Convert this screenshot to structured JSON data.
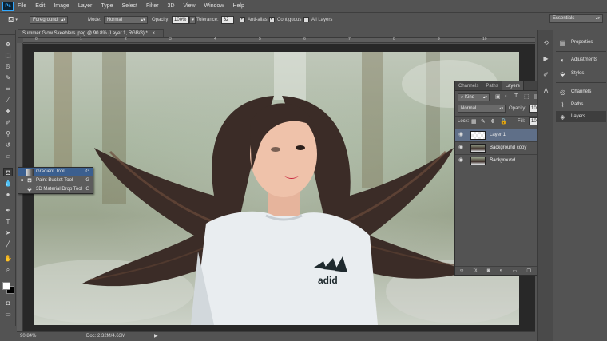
{
  "app": {
    "logo": "Ps"
  },
  "menu": [
    "File",
    "Edit",
    "Image",
    "Layer",
    "Type",
    "Select",
    "Filter",
    "3D",
    "View",
    "Window",
    "Help"
  ],
  "options": {
    "tool_icon": "paint-bucket-icon",
    "fill_source": "Foreground",
    "mode_label": "Mode:",
    "mode_value": "Normal",
    "opacity_label": "Opacity:",
    "opacity_value": "100%",
    "tolerance_label": "Tolerance:",
    "tolerance_value": "32",
    "antialias_label": "Anti-alias",
    "antialias_checked": true,
    "contiguous_label": "Contiguous",
    "contiguous_checked": true,
    "all_layers_label": "All Layers",
    "all_layers_checked": false,
    "workspace": "Essentials"
  },
  "document": {
    "tab_title": "Summer Glow Skeeblers.jpeg @ 90.8% (Layer 1, RGB/8) *",
    "close_glyph": "×"
  },
  "ruler_top_labels": [
    "0",
    "1",
    "2",
    "3",
    "4",
    "5",
    "6",
    "7",
    "8",
    "9",
    "10"
  ],
  "flyout": [
    {
      "label": "Gradient Tool",
      "key": "G",
      "icon": "gradient-icon",
      "selected": true,
      "bullet": ""
    },
    {
      "label": "Paint Bucket Tool",
      "key": "G",
      "icon": "paint-bucket-icon",
      "selected": false,
      "bullet": "■"
    },
    {
      "label": "3D Material Drop Tool",
      "key": "G",
      "icon": "3d-material-drop-icon",
      "selected": false,
      "bullet": ""
    }
  ],
  "layers_panel": {
    "tabs": [
      "Channels",
      "Paths",
      "Layers"
    ],
    "active_tab": "Layers",
    "kind_label": "Kind",
    "blend_mode": "Normal",
    "opacity_label": "Opacity:",
    "opacity_value": "100%",
    "lock_label": "Lock:",
    "fill_label": "Fill:",
    "fill_value": "100%",
    "layers": [
      {
        "name": "Layer 1",
        "selected": true,
        "italic": false,
        "locked": false
      },
      {
        "name": "Background copy",
        "selected": false,
        "italic": false,
        "locked": false
      },
      {
        "name": "Background",
        "selected": false,
        "italic": true,
        "locked": true
      }
    ],
    "bottom_icons": [
      "link-icon",
      "fx-icon",
      "mask-icon",
      "adjustment-icon",
      "group-icon",
      "new-layer-icon",
      "trash-icon"
    ],
    "fx_label": "fx"
  },
  "right_panel": [
    {
      "label": "Properties",
      "icon": "properties-icon",
      "selected": false
    },
    {
      "label": "Adjustments",
      "icon": "adjustments-icon",
      "selected": false
    },
    {
      "label": "Styles",
      "icon": "styles-icon",
      "selected": false
    },
    {
      "label": "Channels",
      "icon": "channels-icon",
      "selected": false
    },
    {
      "label": "Paths",
      "icon": "paths-icon",
      "selected": false
    },
    {
      "label": "Layers",
      "icon": "layers-icon",
      "selected": true
    }
  ],
  "status": {
    "zoom": "90.84%",
    "doc": "Doc: 2.32M/4.63M",
    "arrow": "▶"
  },
  "canvas": {
    "shirt_logo_text": "adid"
  },
  "colors": {
    "foreground": "#ffffff",
    "background": "#000000",
    "accent": "#31a8ff",
    "selection": "#5f6f88"
  }
}
